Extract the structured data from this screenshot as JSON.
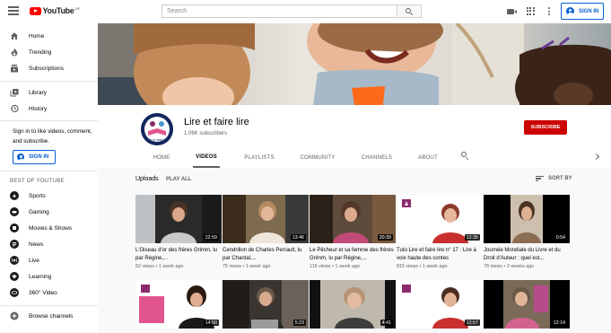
{
  "masthead": {
    "logo_text": "YouTube",
    "logo_country": "DE",
    "search_placeholder": "Search",
    "signin_label": "SIGN IN"
  },
  "sidebar": {
    "main_items": [
      {
        "label": "Home",
        "icon": "home-icon"
      },
      {
        "label": "Trending",
        "icon": "trending-icon"
      },
      {
        "label": "Subscriptions",
        "icon": "subscriptions-icon"
      }
    ],
    "library_items": [
      {
        "label": "Library",
        "icon": "library-icon"
      },
      {
        "label": "History",
        "icon": "history-icon"
      }
    ],
    "signin_message": "Sign in to like videos, comment, and subscribe.",
    "signin_label": "SIGN IN",
    "best_of_heading": "BEST OF YOUTUBE",
    "best_of_items": [
      {
        "label": "Sports",
        "icon": "sports-icon"
      },
      {
        "label": "Gaming",
        "icon": "gaming-icon"
      },
      {
        "label": "Movies & Shows",
        "icon": "movies-icon"
      },
      {
        "label": "News",
        "icon": "news-icon"
      },
      {
        "label": "Live",
        "icon": "live-icon"
      },
      {
        "label": "Learning",
        "icon": "learning-icon"
      },
      {
        "label": "360° Video",
        "icon": "360-video-icon"
      }
    ],
    "browse_channels_label": "Browse channels"
  },
  "channel": {
    "name": "Lire et faire lire",
    "subscribers": "1.06K subscribers",
    "subscribe_label": "SUBSCRIBE",
    "avatar_text": "Lire et faire lire",
    "tabs": [
      "HOME",
      "VIDEOS",
      "PLAYLISTS",
      "COMMUNITY",
      "CHANNELS",
      "ABOUT"
    ],
    "active_tab": "VIDEOS"
  },
  "uploads": {
    "heading": "Uploads",
    "play_all": "PLAY ALL",
    "sort_by": "SORT BY"
  },
  "videos_row1": [
    {
      "title": "L'Oiseau d'or des frères Grimm, lu par Régine,...",
      "views": "52 views",
      "age": "1 week ago",
      "duration": "22:59"
    },
    {
      "title": "Cendrillon de Charles Perrault, lu par Chantal,...",
      "views": "75 views",
      "age": "1 week ago",
      "duration": "13:46"
    },
    {
      "title": "Le Pêcheur et sa femme des frères Grimm, lu par Régine,...",
      "views": "116 views",
      "age": "1 week ago",
      "duration": "20:39"
    },
    {
      "title": "Tuto Lire et faire lire n° 17 : Lire à voix haute des contes",
      "views": "815 views",
      "age": "1 week ago",
      "duration": "13:35"
    },
    {
      "title": "Journée Mondiale du Livre et du Droit d'Auteur : quel est...",
      "views": "78 views",
      "age": "2 weeks ago",
      "duration": "0:54"
    }
  ],
  "videos_row2": [
    {
      "duration": "14:50"
    },
    {
      "duration": "5:23"
    },
    {
      "duration": "4:41"
    },
    {
      "duration": "13:57"
    },
    {
      "duration": "12:14"
    }
  ],
  "colors": {
    "accent_blue": "#065fd4",
    "subscribe_red": "#cc0000",
    "youtube_red": "#ff0000",
    "brand_purple": "#8b2a6e"
  }
}
